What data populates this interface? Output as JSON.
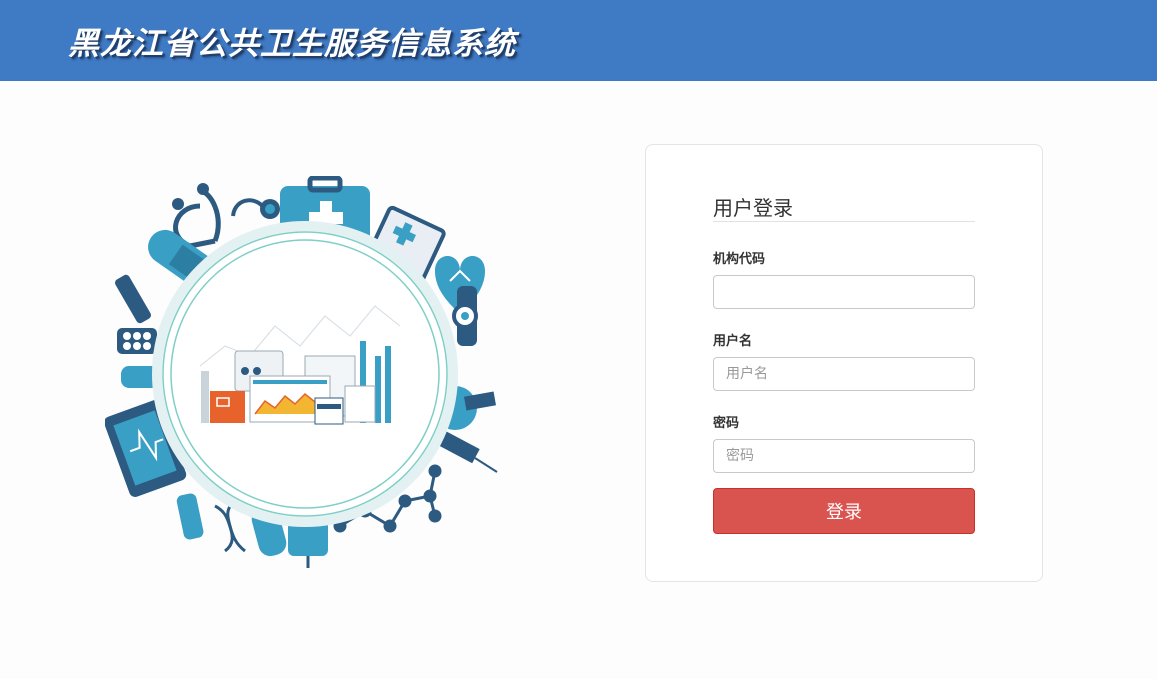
{
  "header": {
    "title": "黑龙江省公共卫生服务信息系统"
  },
  "login": {
    "title": "用户登录",
    "org_code": {
      "label": "机构代码",
      "placeholder": "",
      "value": ""
    },
    "username": {
      "label": "用户名",
      "placeholder": "用户名",
      "value": ""
    },
    "password": {
      "label": "密码",
      "placeholder": "密码",
      "value": ""
    },
    "submit_label": "登录"
  },
  "colors": {
    "header_bg": "#3f7ac4",
    "button_bg": "#d9534f",
    "illustration_teal": "#3a9fc4",
    "illustration_navy": "#2d5a80",
    "ring": "#7fcfc7",
    "orange": "#e8622b",
    "yellow": "#f2b632"
  },
  "illustration": {
    "icons": [
      "stethoscope-icon",
      "first-aid-kit-icon",
      "clipboard-icon",
      "heart-icon",
      "thermometer-icon",
      "flask-icon",
      "syringe-icon",
      "molecule-icon",
      "dna-icon",
      "tablet-icon",
      "pill-pack-icon",
      "bandage-icon",
      "test-tube-icon",
      "iv-bag-icon"
    ]
  }
}
